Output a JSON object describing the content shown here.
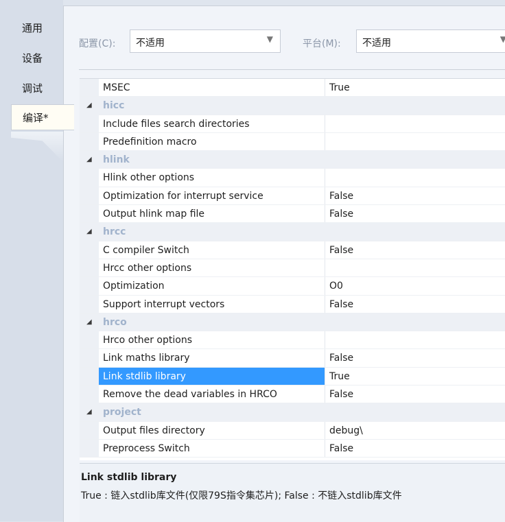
{
  "tabs": [
    {
      "label": "通用"
    },
    {
      "label": "设备"
    },
    {
      "label": "调试"
    },
    {
      "label": "编译*"
    }
  ],
  "toolbar": {
    "config_label": "配置(C):",
    "config_value": "不适用",
    "platform_label": "平台(M):",
    "platform_value": "不适用"
  },
  "rows": [
    {
      "type": "prop",
      "name": "MSEC",
      "value": "True"
    },
    {
      "type": "cat",
      "name": "hicc"
    },
    {
      "type": "prop",
      "name": "Include files search directories",
      "value": ""
    },
    {
      "type": "prop",
      "name": "Predefinition macro",
      "value": ""
    },
    {
      "type": "cat",
      "name": "hlink"
    },
    {
      "type": "prop",
      "name": "Hlink other options",
      "value": ""
    },
    {
      "type": "prop",
      "name": "Optimization for interrupt service",
      "value": "False"
    },
    {
      "type": "prop",
      "name": "Output hlink map file",
      "value": "False"
    },
    {
      "type": "cat",
      "name": "hrcc"
    },
    {
      "type": "prop",
      "name": "C compiler Switch",
      "value": "False"
    },
    {
      "type": "prop",
      "name": "Hrcc other options",
      "value": ""
    },
    {
      "type": "prop",
      "name": "Optimization",
      "value": "O0"
    },
    {
      "type": "prop",
      "name": "Support interrupt vectors",
      "value": "False"
    },
    {
      "type": "cat",
      "name": "hrco"
    },
    {
      "type": "prop",
      "name": "Hrco other options",
      "value": ""
    },
    {
      "type": "prop",
      "name": "Link maths library",
      "value": "False"
    },
    {
      "type": "prop",
      "name": "Link stdlib library",
      "value": "True",
      "selected": true
    },
    {
      "type": "prop",
      "name": "Remove the dead variables in HRCO",
      "value": "False"
    },
    {
      "type": "cat",
      "name": "project"
    },
    {
      "type": "prop",
      "name": "Output files directory",
      "value": "debug\\"
    },
    {
      "type": "prop",
      "name": "Preprocess Switch",
      "value": "False"
    }
  ],
  "description": {
    "title": "Link stdlib library",
    "text": "True : 链入stdlib库文件(仅限79S指令集芯片); False : 不链入stdlib库文件"
  },
  "colors": {
    "selection": "#3399ff",
    "category_text": "#a1b3cc"
  }
}
